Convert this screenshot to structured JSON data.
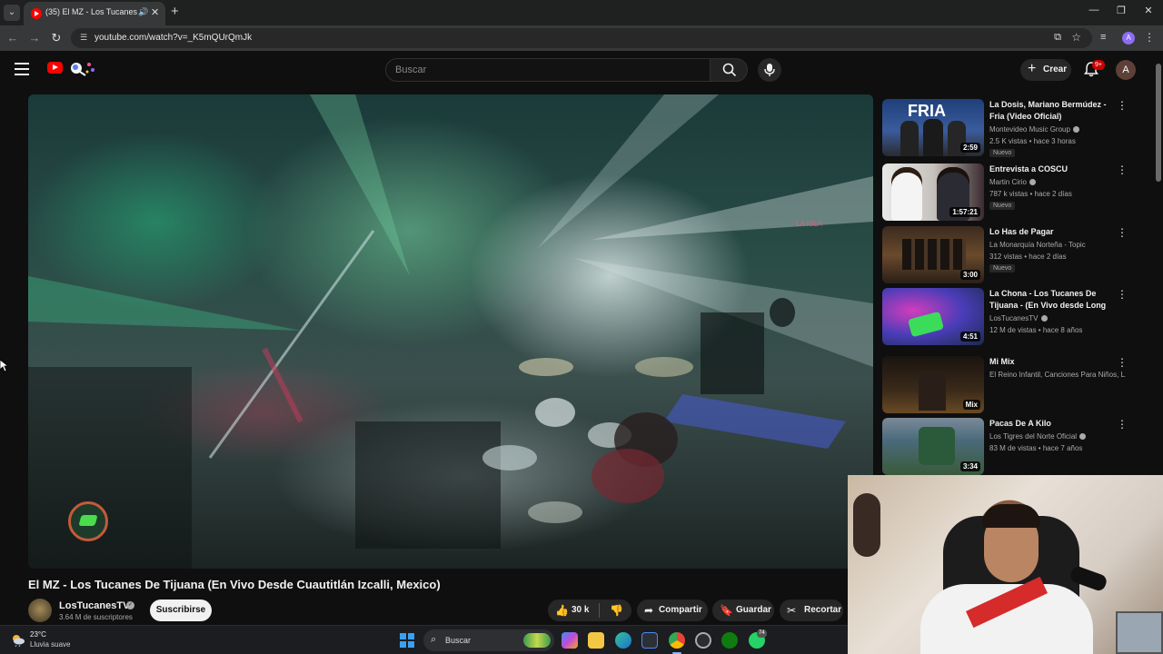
{
  "browser": {
    "tab_title": "(35) El MZ - Los Tucanes De Tijuana",
    "url": "youtube.com/watch?v=_K5mQUrQmJk",
    "profile_initial": "A"
  },
  "masthead": {
    "search_placeholder": "Buscar",
    "create_label": "Crear",
    "notification_count": "9+",
    "avatar_initial": "A"
  },
  "player": {
    "watermark": "LA ISLA"
  },
  "video": {
    "title": "El MZ - Los Tucanes De Tijuana (En Vivo Desde Cuautitlán Izcalli, Mexico)",
    "channel_name": "LosTucanesTV",
    "subscriber_count": "3.64 M de suscriptores",
    "subscribe_label": "Suscribirse",
    "like_count": "30 k",
    "share_label": "Compartir",
    "save_label": "Guardar",
    "clip_label": "Recortar"
  },
  "recommendations": [
    {
      "title": "La Dosis, Mariano Bermúdez - Fria (Video Oficial)",
      "channel": "Montevideo Music Group",
      "verified": true,
      "meta": "2.5 K vistas • hace 3 horas",
      "badge": "Nuevo",
      "duration": "2:59",
      "thumb_text": "FRIA"
    },
    {
      "title": "Entrevista a COSCU",
      "channel": "Martin Cirio",
      "verified": true,
      "meta": "787 k vistas • hace 2 días",
      "badge": "Nuevo",
      "duration": "1:57:21"
    },
    {
      "title": "Lo Has de Pagar",
      "channel": "La Monarquía Norteña - Topic",
      "verified": false,
      "meta": "312 vistas • hace 2 días",
      "badge": "Nuevo",
      "duration": "3:00"
    },
    {
      "title": "La Chona - Los Tucanes De Tijuana - (En Vivo desde Long ...",
      "channel": "LosTucanesTV",
      "verified": true,
      "meta": "12 M de vistas • hace 8 años",
      "badge": "",
      "duration": "4:51"
    },
    {
      "title": "Mi Mix",
      "channel": "El Reino Infantil, Canciones Para Niños, L...",
      "verified": false,
      "meta": "",
      "badge": "",
      "duration": "Mix"
    },
    {
      "title": "Pacas De A Kilo",
      "channel": "Los Tigres del Norte Oficial",
      "verified": true,
      "meta": "83 M de vistas • hace 7 años",
      "badge": "",
      "duration": "3:34"
    }
  ],
  "taskbar": {
    "temperature": "23°C",
    "weather": "Lluvia suave",
    "search_label": "Buscar",
    "badge_count": "74"
  }
}
